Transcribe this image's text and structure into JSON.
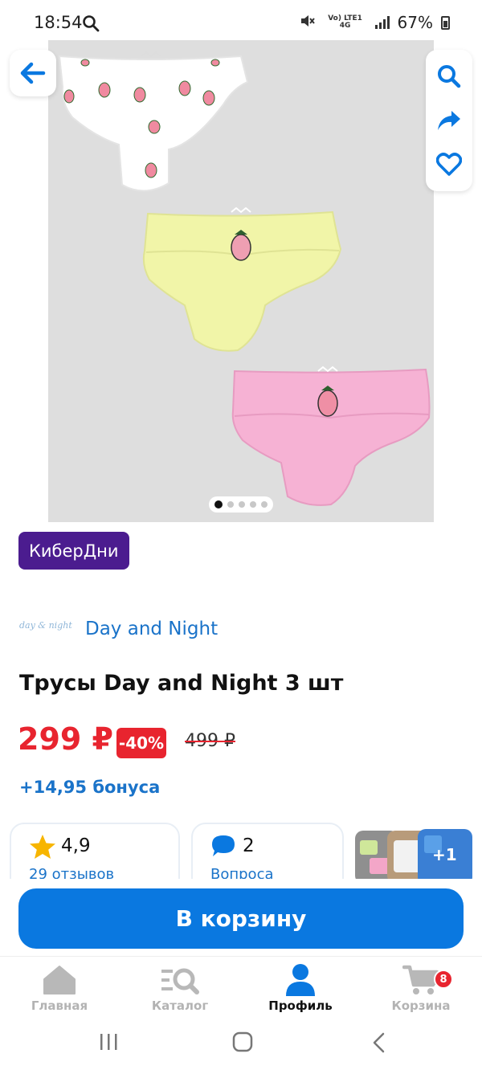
{
  "status_bar": {
    "time": "18:54",
    "network": "Vo) LTE1 4G",
    "battery": "67%"
  },
  "gallery": {
    "image_count": 5,
    "active_index": 0
  },
  "promo": {
    "badge": "КиберДни"
  },
  "brand": {
    "logo_text": "day & night",
    "name": "Day and Night"
  },
  "product": {
    "title": "Трусы Day and Night 3 шт",
    "price": "299 ₽",
    "discount": "-40%",
    "old_price": "499 ₽",
    "bonus": "+14,95 бонуса"
  },
  "stats": {
    "rating": "4,9",
    "reviews": "29 отзывов",
    "questions_count": "2",
    "questions_label": "Вопроса",
    "photos_more": "+1"
  },
  "cart_button": "В корзину",
  "bottom_nav": {
    "items": [
      {
        "label": "Главная",
        "icon": "home-icon"
      },
      {
        "label": "Каталог",
        "icon": "catalog-search-icon"
      },
      {
        "label": "Профиль",
        "icon": "profile-icon"
      },
      {
        "label": "Корзина",
        "icon": "cart-icon"
      }
    ],
    "active_index": 2,
    "cart_badge": "8"
  },
  "colors": {
    "accent": "#0a78e0",
    "price": "#e8242f",
    "promo": "#4b1c8f"
  }
}
